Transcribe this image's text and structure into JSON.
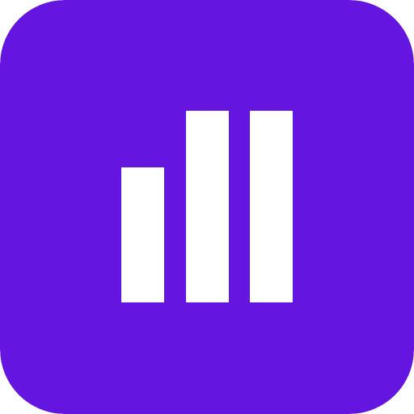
{
  "icon": {
    "name": "bar-chart-app-icon",
    "glyph": "bar-chart-icon",
    "background_color": "#6415df",
    "bar_color": "#ffffff",
    "bar_levels": [
      0.705,
      1.0,
      1.0
    ]
  }
}
